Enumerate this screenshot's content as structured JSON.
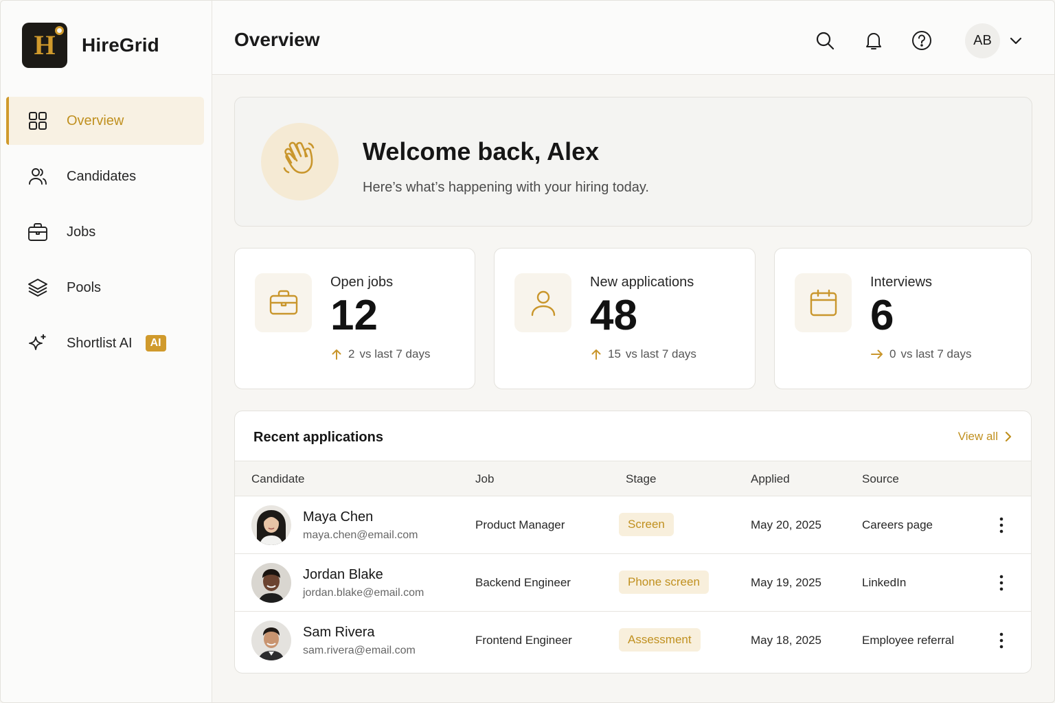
{
  "app": {
    "name": "HireGrid",
    "logo_letter": "H"
  },
  "sidebar": {
    "items": [
      {
        "label": "Overview",
        "icon": "grid-icon",
        "active": true
      },
      {
        "label": "Candidates",
        "icon": "users-icon"
      },
      {
        "label": "Jobs",
        "icon": "briefcase-icon"
      },
      {
        "label": "Pools",
        "icon": "layers-icon"
      },
      {
        "label": "Shortlist AI",
        "icon": "sparkle-icon",
        "badge": "AI"
      }
    ]
  },
  "header": {
    "title": "Overview",
    "avatar_initials": "AB",
    "icons": [
      "search-icon",
      "bell-icon",
      "help-icon",
      "chevron-down-icon"
    ]
  },
  "welcome": {
    "title": "Welcome back, Alex",
    "subtitle": "Here’s what’s happening with your hiring today."
  },
  "stats": [
    {
      "label": "Open jobs",
      "value": "12",
      "delta": "2",
      "delta_text": "vs last 7 days",
      "trend": "up"
    },
    {
      "label": "New applications",
      "value": "48",
      "delta": "15",
      "delta_text": "vs last 7 days",
      "trend": "up"
    },
    {
      "label": "Interviews",
      "value": "6",
      "delta": "0",
      "delta_text": "vs last 7 days",
      "trend": "flat"
    }
  ],
  "recent": {
    "title": "Recent applications",
    "view_all": "View all",
    "columns": [
      "Candidate",
      "Job",
      "Stage",
      "Applied",
      "Source"
    ],
    "rows": [
      {
        "name": "Maya Chen",
        "email": "maya.chen@email.com",
        "job": "Product Manager",
        "stage": "Screen",
        "applied": "May 20, 2025",
        "source": "Careers page"
      },
      {
        "name": "Jordan Blake",
        "email": "jordan.blake@email.com",
        "job": "Backend Engineer",
        "stage": "Phone screen",
        "applied": "May 19, 2025",
        "source": "LinkedIn"
      },
      {
        "name": "Sam Rivera",
        "email": "sam.rivera@email.com",
        "job": "Frontend Engineer",
        "stage": "Assessment",
        "applied": "May 18, 2025",
        "source": "Employee referral"
      }
    ]
  },
  "colors": {
    "accent": "#d09a2c",
    "accent_text": "#c0901f",
    "accent_bg": "#f8f1e3"
  }
}
